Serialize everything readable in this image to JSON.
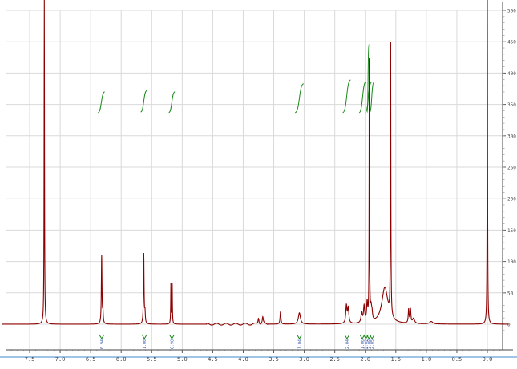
{
  "chart_data": {
    "type": "line",
    "title": "",
    "xlabel": "",
    "ylabel": "",
    "x_reversed": true,
    "xlim": [
      8.0,
      -0.4
    ],
    "ylim": [
      -10,
      500
    ],
    "grid": true,
    "x_ticks": [
      "7.5",
      "7.0",
      "6.5",
      "6.0",
      "5.5",
      "5.0",
      "4.5",
      "4.0",
      "3.5",
      "3.0",
      "2.5",
      "2.0",
      "1.5",
      "1.0",
      "0.5",
      "0.0"
    ],
    "y_ticks": [
      "0",
      "50",
      "100",
      "150",
      "200",
      "250",
      "300",
      "350",
      "400",
      "450",
      "500"
    ],
    "spectrum_color": "#8b0000",
    "integral_color": "#1a8a1a",
    "peak_label_color": "#3355aa",
    "peaks": [
      {
        "ppm": 7.26,
        "height": 520,
        "width": 0.004
      },
      {
        "ppm": 6.32,
        "height": 109,
        "width": 0.006
      },
      {
        "ppm": 6.3,
        "height": 20,
        "width": 0.006
      },
      {
        "ppm": 5.63,
        "height": 112,
        "width": 0.006
      },
      {
        "ppm": 5.61,
        "height": 18,
        "width": 0.006
      },
      {
        "ppm": 5.185,
        "height": 67,
        "width": 0.004
      },
      {
        "ppm": 5.165,
        "height": 67,
        "width": 0.004
      },
      {
        "ppm": 3.75,
        "height": 10,
        "width": 0.01
      },
      {
        "ppm": 3.68,
        "height": 11,
        "width": 0.01
      },
      {
        "ppm": 3.39,
        "height": 20,
        "width": 0.008
      },
      {
        "ppm": 3.08,
        "height": 18,
        "width": 0.02
      },
      {
        "ppm": 2.31,
        "height": 28,
        "width": 0.012
      },
      {
        "ppm": 2.28,
        "height": 24,
        "width": 0.012
      },
      {
        "ppm": 2.06,
        "height": 16,
        "width": 0.012
      },
      {
        "ppm": 2.02,
        "height": 26,
        "width": 0.012
      },
      {
        "ppm": 1.97,
        "height": 30,
        "width": 0.01
      },
      {
        "ppm": 1.93,
        "height": 34,
        "width": 0.01
      },
      {
        "ppm": 1.905,
        "height": 18,
        "width": 0.01
      },
      {
        "ppm": 1.89,
        "height": 12,
        "width": 0.01
      },
      {
        "ppm": 1.68,
        "height": 58,
        "width": 0.06
      },
      {
        "ppm": 1.585,
        "height": 460,
        "width": 0.004
      },
      {
        "ppm": 1.29,
        "height": 22,
        "width": 0.008
      },
      {
        "ppm": 1.26,
        "height": 22,
        "width": 0.008
      },
      {
        "ppm": 1.21,
        "height": 8,
        "width": 0.02
      },
      {
        "ppm": 0.92,
        "height": 4,
        "width": 0.03
      },
      {
        "ppm": 0.0,
        "height": 520,
        "width": 0.004
      },
      {
        "ppm": 1.935,
        "height": 430,
        "width": 0.003
      }
    ],
    "integrals": [
      {
        "ppm_start": 6.38,
        "ppm_end": 6.27,
        "bottom": 337,
        "top": 370
      },
      {
        "ppm_start": 5.68,
        "ppm_end": 5.58,
        "bottom": 338,
        "top": 372
      },
      {
        "ppm_start": 5.22,
        "ppm_end": 5.12,
        "bottom": 337,
        "top": 370
      },
      {
        "ppm_start": 3.15,
        "ppm_end": 3.01,
        "bottom": 337,
        "top": 383
      },
      {
        "ppm_start": 2.37,
        "ppm_end": 2.24,
        "bottom": 337,
        "top": 389
      },
      {
        "ppm_start": 2.1,
        "ppm_end": 1.99,
        "bottom": 337,
        "top": 386
      },
      {
        "ppm_start": 2.0,
        "ppm_end": 1.9,
        "bottom": 337,
        "top": 385
      },
      {
        "ppm_start": 1.97,
        "ppm_end": 1.94,
        "bottom": 337,
        "top": 446
      },
      {
        "ppm_start": 1.93,
        "ppm_end": 1.86,
        "bottom": 337,
        "top": 385
      }
    ],
    "integral_labels": [
      {
        "ppm": 6.32,
        "text": "0.94"
      },
      {
        "ppm": 5.62,
        "text": "1.00"
      },
      {
        "ppm": 5.17,
        "text": "0.98"
      },
      {
        "ppm": 3.08,
        "text": "1.04"
      },
      {
        "ppm": 2.3,
        "text": "2.04"
      },
      {
        "ppm": 2.05,
        "text": "1.06"
      },
      {
        "ppm": 1.99,
        "text": "2.02"
      },
      {
        "ppm": 1.94,
        "text": "3.08"
      },
      {
        "ppm": 1.89,
        "text": "2.05"
      }
    ]
  }
}
